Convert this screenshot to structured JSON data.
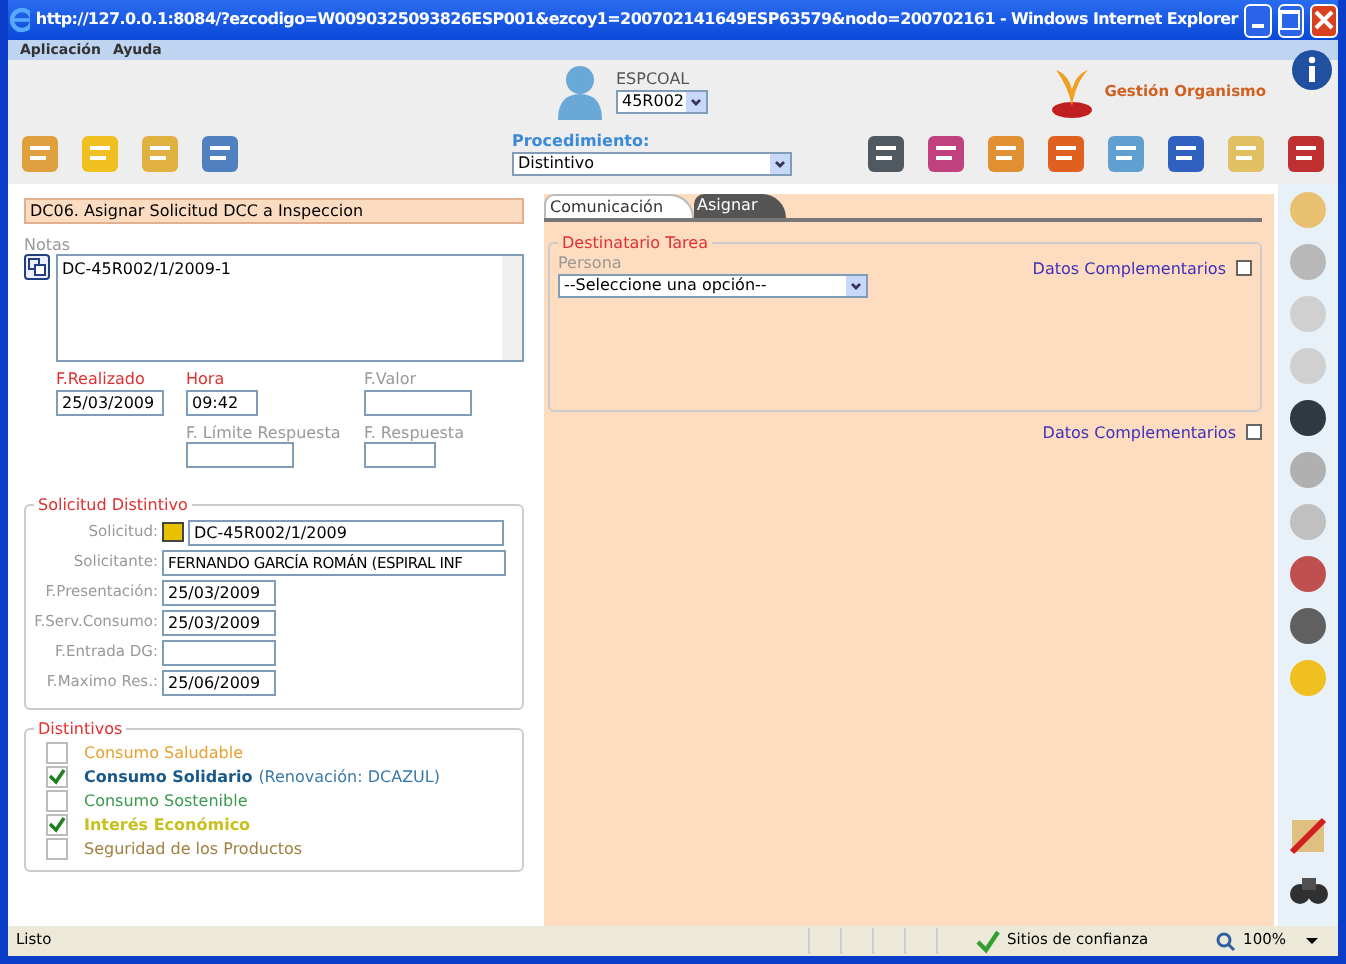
{
  "window": {
    "title": "http://127.0.0.1:8084/?ezcodigo=W0090325093826ESP001&ezcoy1=200702141649ESP63579&nodo=200702161 - Windows Internet Explorer"
  },
  "menu": [
    "Aplicación",
    "Ayuda"
  ],
  "header": {
    "user": "ESPCOAL",
    "unit": "45R002",
    "brand": "Gestión Organismo"
  },
  "procedimiento": {
    "label": "Procedimiento:",
    "value": "Distintivo"
  },
  "task": {
    "title": "DC06. Asignar Solicitud DCC a Inspeccion",
    "notes_label": "Notas",
    "notes": "DC-45R002/1/2009-1",
    "date_rows": [
      [
        {
          "label": "F.Realizado",
          "value": "25/03/2009",
          "required": true
        },
        {
          "label": "Hora",
          "value": "09:42",
          "required": true
        },
        {
          "label": "F.Valor",
          "required": false
        }
      ],
      [
        {
          "label": "F. Límite Respuesta",
          "required": false
        },
        {
          "label": "F. Respuesta",
          "required": false
        }
      ]
    ]
  },
  "solicitud": {
    "legend": "Solicitud Distintivo",
    "fields": [
      {
        "label": "Solicitud:",
        "value": "DC-45R002/1/2009",
        "kind": "lookup"
      },
      {
        "label": "Solicitante:",
        "value": "FERNANDO GARCÍA ROMÁN (ESPIRAL INF",
        "kind": "wide"
      },
      {
        "label": "F.Presentación:",
        "value": "25/03/2009",
        "kind": "date"
      },
      {
        "label": "F.Serv.Consumo:",
        "value": "25/03/2009",
        "kind": "date"
      },
      {
        "label": "F.Entrada DG:",
        "kind": "date"
      },
      {
        "label": "F.Maximo Res.:",
        "value": "25/06/2009",
        "kind": "date"
      }
    ]
  },
  "distintivos": {
    "legend": "Distintivos",
    "items": [
      {
        "label": "Consumo Saludable",
        "checked": false,
        "color": "#e8a030"
      },
      {
        "label": "Consumo Solidario",
        "checked": true,
        "color": "#1a5a8a",
        "note": "(Renovación: DCAZUL)"
      },
      {
        "label": "Consumo Sostenible",
        "checked": false,
        "color": "#3a9a50"
      },
      {
        "label": "Interés Económico",
        "checked": true,
        "color": "#c8c020"
      },
      {
        "label": "Seguridad de los Productos",
        "checked": false,
        "color": "#a08040"
      }
    ]
  },
  "tabs": [
    {
      "label": "Comunicación",
      "selected": true
    },
    {
      "label": "Asignar",
      "selected": false
    }
  ],
  "destinatario": {
    "legend": "Destinatario Tarea",
    "persona_label": "Persona",
    "persona_placeholder": "--Seleccione una opción--",
    "link": "Datos Complementarios"
  },
  "datos_link": "Datos Complementarios",
  "status_bar": {
    "text": "Listo",
    "zone": "Sitios de confianza",
    "zoom": "100%"
  }
}
